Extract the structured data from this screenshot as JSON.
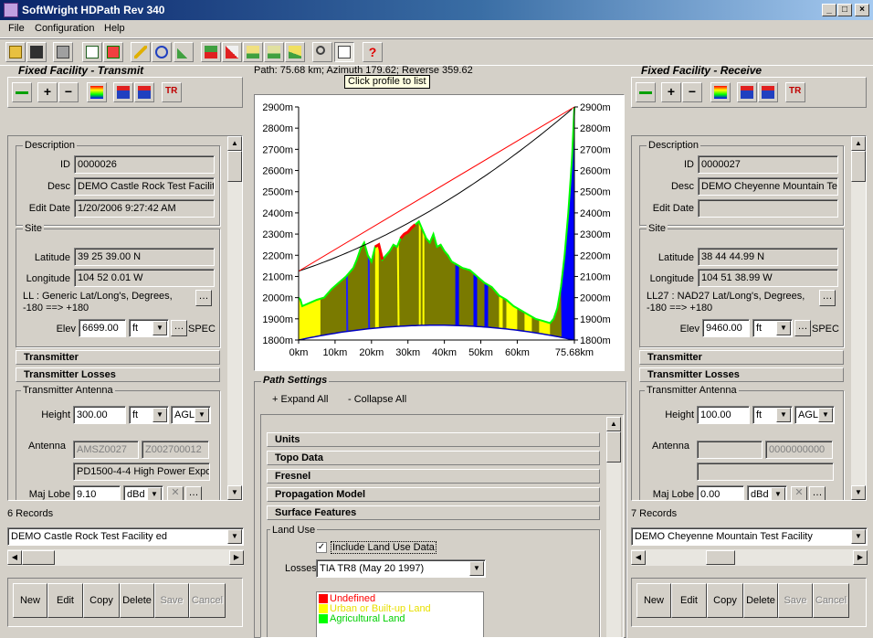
{
  "window": {
    "title": "SoftWright HDPath Rev 340",
    "min": "_",
    "max": "□",
    "close": "×"
  },
  "menu": [
    "File",
    "Configuration",
    "Help"
  ],
  "path_info": "Path: 75.68 km; Azimuth 179.62; Reverse 359.62",
  "tooltip": "Click profile to list",
  "left": {
    "section_title": "Fixed Facility - Transmit",
    "description": {
      "legend": "Description",
      "id_label": "ID",
      "id": "0000026",
      "desc_label": "Desc",
      "desc": "DEMO Castle Rock Test Facilit",
      "edit_label": "Edit Date",
      "edit": "1/20/2006 9:27:42 AM"
    },
    "site": {
      "legend": "Site",
      "lat_label": "Latitude",
      "lat": "39 25 39.00 N",
      "lon_label": "Longitude",
      "lon": "104 52 0.01 W",
      "ll": "LL : Generic Lat/Long's, Degrees, -180 ==> +180",
      "elev_label": "Elev",
      "elev": "6699.00",
      "unit": "ft",
      "spec": "SPEC"
    },
    "hdr1": "Transmitter",
    "hdr2": "Transmitter Losses",
    "antenna": {
      "legend": "Transmitter Antenna",
      "height_label": "Height",
      "height": "300.00",
      "unit": "ft",
      "ref": "AGL",
      "ant_label": "Antenna",
      "a1": "AMSZ0027",
      "a2": "Z002700012",
      "model": "PD1500-4-4 High Power Expo",
      "lobe_label": "Maj Lobe",
      "lobe": "9.10",
      "lobe_unit": "dBd"
    },
    "records": "6 Records",
    "selected": "DEMO Castle Rock Test Facility ed",
    "buttons": [
      "New",
      "Edit",
      "Copy",
      "Delete",
      "Save",
      "Cancel"
    ]
  },
  "right": {
    "section_title": "Fixed Facility - Receive",
    "description": {
      "legend": "Description",
      "id_label": "ID",
      "id": "0000027",
      "desc_label": "Desc",
      "desc": "DEMO Cheyenne Mountain Te",
      "edit_label": "Edit Date",
      "edit": ""
    },
    "site": {
      "legend": "Site",
      "lat_label": "Latitude",
      "lat": "38 44 44.99 N",
      "lon_label": "Longitude",
      "lon": "104 51 38.99 W",
      "ll": "LL27 : NAD27 Lat/Long's, Degrees, -180 ==> +180",
      "elev_label": "Elev",
      "elev": "9460.00",
      "unit": "ft",
      "spec": "SPEC"
    },
    "hdr1": "Transmitter",
    "hdr2": "Transmitter Losses",
    "antenna": {
      "legend": "Transmitter Antenna",
      "height_label": "Height",
      "height": "100.00",
      "unit": "ft",
      "ref": "AGL",
      "ant_label": "Antenna",
      "a1": "",
      "a2": "0000000000",
      "model": "",
      "lobe_label": "Maj Lobe",
      "lobe": "0.00",
      "lobe_unit": "dBd"
    },
    "records": "7 Records",
    "selected": "DEMO Cheyenne Mountain Test Facility",
    "buttons": [
      "New",
      "Edit",
      "Copy",
      "Delete",
      "Save",
      "Cancel"
    ]
  },
  "path_settings": {
    "title": "Path Settings",
    "expand": "+ Expand All",
    "collapse": "- Collapse All",
    "sections": [
      "Units",
      "Topo Data",
      "Fresnel",
      "Propagation Model",
      "Surface Features"
    ],
    "landuse": {
      "legend": "Land Use",
      "include": "Include Land Use Data",
      "losses_label": "Losses",
      "losses": "TIA TR8 (May 20 1997)",
      "legend_items": [
        {
          "name": "Undefined",
          "color": "#ff0000"
        },
        {
          "name": "Urban or Built-up Land",
          "color": "#ffff00"
        },
        {
          "name": "Agricultural Land",
          "color": "#00ff00"
        }
      ]
    }
  },
  "chart_data": {
    "type": "area",
    "xlabels": [
      "0km",
      "10km",
      "20km",
      "30km",
      "40km",
      "50km",
      "60km",
      "75.68km"
    ],
    "x_ticks_km": [
      0,
      10,
      20,
      30,
      40,
      50,
      60,
      75.68
    ],
    "xlim": [
      0,
      75.68
    ],
    "ylim": [
      1800,
      2900
    ],
    "yticks": [
      "1800m",
      "1900m",
      "2000m",
      "2100m",
      "2200m",
      "2300m",
      "2400m",
      "2500m",
      "2600m",
      "2700m",
      "2800m",
      "2900m"
    ],
    "tx_height_m": 2125,
    "rx_height_m": 2900,
    "profile_km": [
      0,
      0.5,
      1,
      3,
      5,
      7,
      9,
      11,
      13,
      15,
      16,
      17,
      18,
      19,
      20,
      21,
      22,
      23,
      24,
      25,
      26,
      27,
      28,
      29,
      30,
      31,
      32,
      33,
      34,
      35,
      36,
      37,
      38,
      39,
      40,
      41,
      42,
      43,
      44,
      45,
      47,
      49,
      51,
      53,
      55,
      57,
      59,
      61,
      63,
      65,
      67,
      69,
      70,
      71,
      72,
      73,
      74,
      75,
      75.68
    ],
    "profile_m": [
      2000,
      1990,
      1960,
      1975,
      1990,
      2000,
      2040,
      2070,
      2100,
      2140,
      2180,
      2230,
      2260,
      2200,
      2170,
      2240,
      2250,
      2180,
      2200,
      2220,
      2250,
      2240,
      2280,
      2300,
      2310,
      2330,
      2345,
      2360,
      2320,
      2280,
      2260,
      2300,
      2240,
      2250,
      2220,
      2200,
      2170,
      2160,
      2150,
      2140,
      2130,
      2100,
      2070,
      2050,
      2010,
      1990,
      1960,
      1940,
      1920,
      1900,
      1890,
      1880,
      1900,
      1950,
      2050,
      2200,
      2400,
      2650,
      2900
    ]
  }
}
